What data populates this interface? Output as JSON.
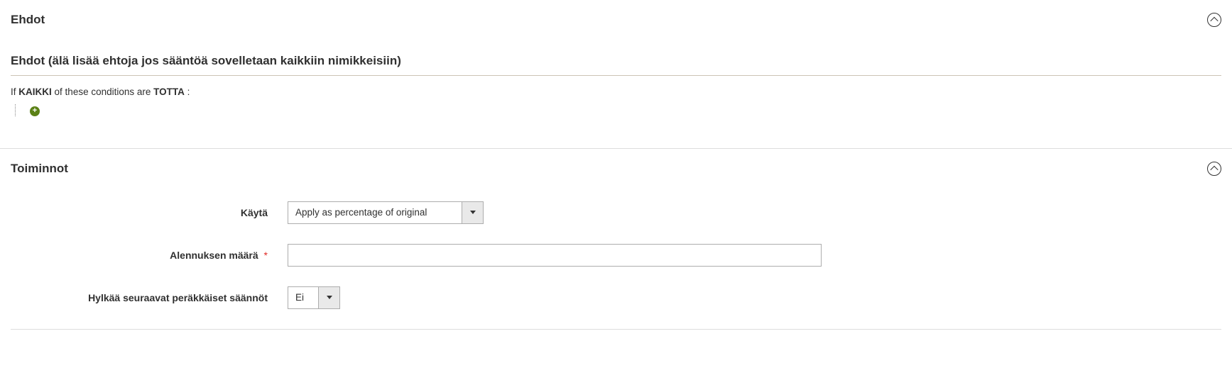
{
  "sections": {
    "conditions": {
      "title": "Ehdot",
      "legend": "Ehdot (älä lisää ehtoja jos sääntöä sovelletaan kaikkiin nimikkeisiin)",
      "rule_prefix": "If",
      "rule_aggregator": "KAIKKI",
      "rule_mid": " of these conditions are",
      "rule_value": "TOTTA",
      "rule_colon": ":"
    },
    "actions": {
      "title": "Toiminnot",
      "fields": {
        "apply": {
          "label": "Käytä",
          "value": "Apply as percentage of original"
        },
        "discount_amount": {
          "label": "Alennuksen määrä",
          "required": true,
          "value": ""
        },
        "stop_rules": {
          "label": "Hylkää seuraavat peräkkäiset säännöt",
          "value": "Ei"
        }
      }
    }
  }
}
